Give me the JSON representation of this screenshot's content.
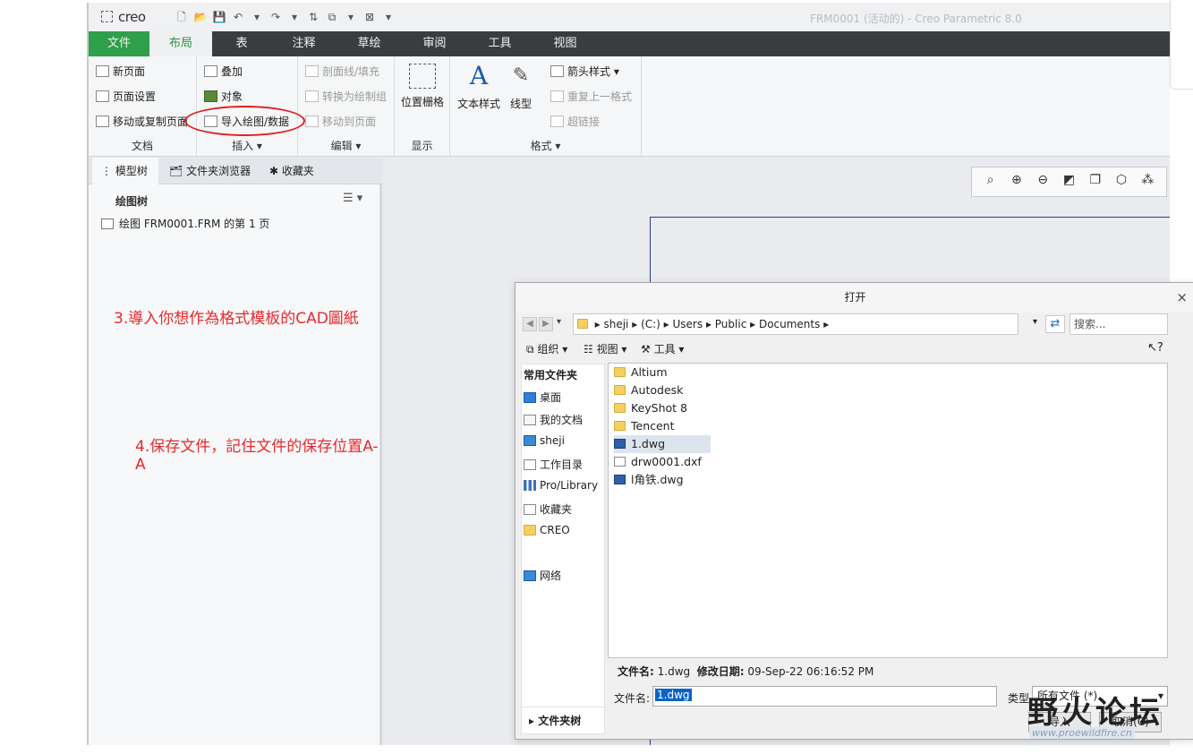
{
  "app": {
    "logo": "creo",
    "window_title": "FRM0001 (活动的) - Creo Parametric 8.0"
  },
  "tabs": [
    "文件",
    "布局",
    "表",
    "注释",
    "草绘",
    "审阅",
    "工具",
    "视图"
  ],
  "ribbon": {
    "document": {
      "label": "文档",
      "items": [
        "新页面",
        "页面设置",
        "移动或复制页面"
      ]
    },
    "insert": {
      "label": "插入",
      "items": [
        "叠加",
        "对象",
        "导入绘图/数据"
      ]
    },
    "edit": {
      "label": "编辑",
      "items": [
        "剖面线/填充",
        "转换为绘制组",
        "移动到页面"
      ]
    },
    "display": {
      "label": "显示",
      "button": "位置栅格"
    },
    "format": {
      "label": "格式",
      "text_style": "文本样式",
      "line_style": "线型",
      "items": [
        "箭头样式",
        "重复上一格式",
        "超链接"
      ]
    }
  },
  "left_panel": {
    "tabs": [
      "模型树",
      "文件夹浏览器",
      "收藏夹"
    ],
    "tree_title": "绘图树",
    "tree_item": "绘图 FRM0001.FRM 的第 1 页"
  },
  "notes": {
    "step3": "3.導入你想作為格式模板的CAD圖紙",
    "step4": "4.保存文件，記住文件的保存位置A-A"
  },
  "dialog": {
    "title": "打开",
    "close": "×",
    "path": [
      "sheji",
      "(C:)",
      "Users",
      "Public",
      "Documents"
    ],
    "search_placeholder": "搜索...",
    "toolbar": [
      "组织",
      "视图",
      "工具"
    ],
    "sidebar_header": "常用文件夹",
    "sidebar": [
      "桌面",
      "我的文档",
      "sheji",
      "工作目录",
      "Pro/Library",
      "收藏夹",
      "CREO",
      "网络"
    ],
    "sidebar_footer": "文件夹树",
    "files": [
      {
        "name": "Altium",
        "type": "folder"
      },
      {
        "name": "Autodesk",
        "type": "folder"
      },
      {
        "name": "KeyShot 8",
        "type": "folder"
      },
      {
        "name": "Tencent",
        "type": "folder"
      },
      {
        "name": "1.dwg",
        "type": "dwg"
      },
      {
        "name": "drw0001.dxf",
        "type": "dxf"
      },
      {
        "name": "l角铁.dwg",
        "type": "dwg"
      }
    ],
    "info_label_name": "文件名:",
    "info_name": "1.dwg",
    "info_label_date": "修改日期:",
    "info_date": "09-Sep-22 06:16:52 PM",
    "filename_label": "文件名:",
    "filename_value": "1.dwg",
    "type_label": "类型",
    "type_value": "所有文件 (*)",
    "import_button": "导入",
    "cancel_button": "取消(C)"
  },
  "watermark": {
    "text": "野火论坛",
    "url": "www.proewildfire.cn"
  }
}
